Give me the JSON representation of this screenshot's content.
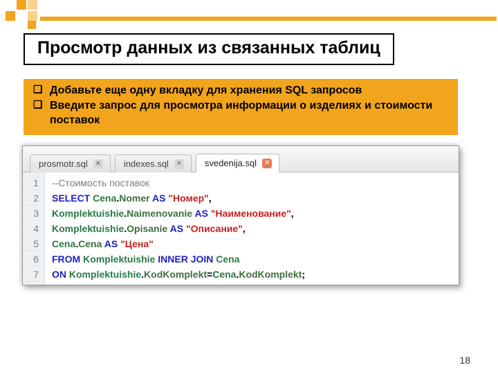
{
  "pageNumber": "18",
  "title": "Просмотр данных из связанных таблиц",
  "bullets": [
    "Добавьте еще одну вкладку для хранения SQL запросов",
    "Введите запрос для просмотра информации о изделиях и стоимости поставок"
  ],
  "tabs": [
    {
      "label": "prosmotr.sql",
      "active": false
    },
    {
      "label": "indexes.sql",
      "active": false
    },
    {
      "label": "svedenija.sql",
      "active": true
    }
  ],
  "code": {
    "gutters": [
      "1",
      "2",
      "3",
      "4",
      "5",
      "6",
      "7"
    ],
    "l1_comment": "--Стоимость поставок",
    "l2_kw1": "SELECT ",
    "l2_tbl": "Cena",
    "l2_dot": ".",
    "l2_col": "Nomer",
    "l2_kw2": " AS ",
    "l2_str": "\"Номер\"",
    "l2_end": ",",
    "l3_tbl": "Komplektuishie",
    "l3_dot": ".",
    "l3_col": "Naimenovanie",
    "l3_kw": " AS ",
    "l3_str": "\"Наименование\"",
    "l3_end": ",",
    "l4_tbl": "Komplektuishie",
    "l4_dot": ".",
    "l4_col": "Opisanie",
    "l4_kw": " AS ",
    "l4_str": "\"Описание\"",
    "l4_end": ",",
    "l5_tbl": "Cena",
    "l5_dot": ".",
    "l5_col": "Cena",
    "l5_kw": " AS ",
    "l5_str": "\"Цена\"",
    "l6_kw1": "FROM ",
    "l6_t1": "Komplektuishie",
    "l6_kw2": " INNER JOIN ",
    "l6_t2": "Cena",
    "l7_kw": "ON ",
    "l7_t1": "Komplektuishie",
    "l7_d1": ".",
    "l7_c1": "KodKomplekt",
    "l7_eq": "=",
    "l7_t2": "Cena",
    "l7_d2": ".",
    "l7_c2": "KodKomplekt",
    "l7_end": ";"
  }
}
